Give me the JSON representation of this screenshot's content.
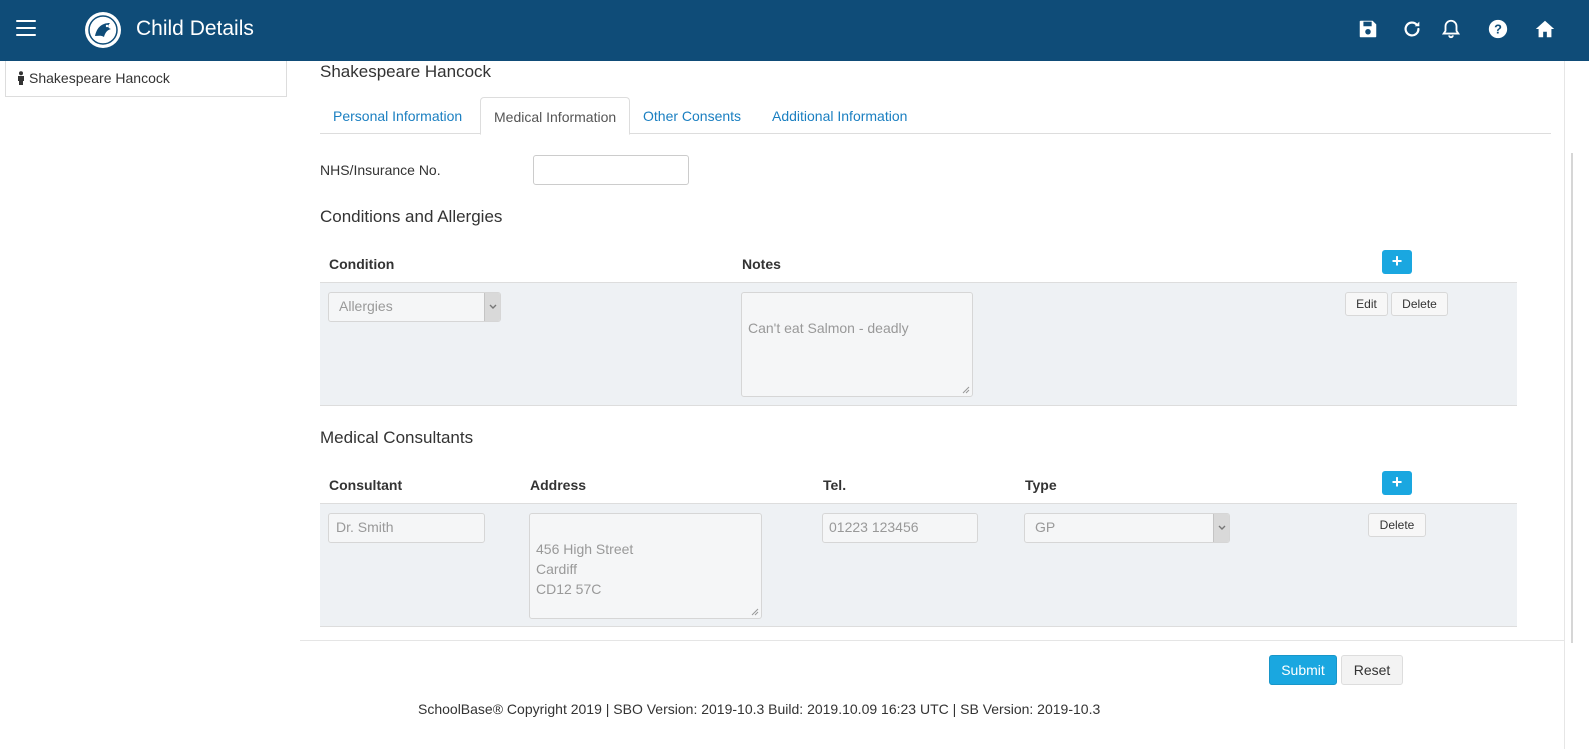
{
  "header": {
    "title": "Child Details",
    "icons": [
      "menu-icon",
      "logo",
      "save-icon",
      "refresh-icon",
      "bell-icon",
      "help-icon",
      "home-icon"
    ],
    "background": "#0f4c78"
  },
  "sidebar": {
    "items": [
      {
        "label": "Shakespeare Hancock",
        "icon": "person-icon"
      }
    ]
  },
  "main": {
    "student_name": "Shakespeare Hancock",
    "tabs": [
      {
        "label": "Personal Information",
        "active": false
      },
      {
        "label": "Medical Information",
        "active": true
      },
      {
        "label": "Other Consents",
        "active": false
      },
      {
        "label": "Additional Information",
        "active": false
      }
    ],
    "nhs": {
      "label": "NHS/Insurance No.",
      "value": ""
    },
    "conditions": {
      "heading": "Conditions and Allergies",
      "columns": [
        "Condition",
        "Notes"
      ],
      "add_label": "+",
      "rows": [
        {
          "condition": "Allergies",
          "notes": "Can't eat Salmon - deadly",
          "edit_label": "Edit",
          "delete_label": "Delete"
        }
      ]
    },
    "consultants": {
      "heading": "Medical Consultants",
      "columns": [
        "Consultant",
        "Address",
        "Tel.",
        "Type"
      ],
      "add_label": "+",
      "rows": [
        {
          "consultant": "Dr. Smith",
          "address": "456 High Street\nCardiff\nCD12 57C",
          "tel": "01223 123456",
          "type": "GP",
          "delete_label": "Delete"
        }
      ]
    }
  },
  "actions": {
    "submit_label": "Submit",
    "reset_label": "Reset"
  },
  "footer": {
    "text": "SchoolBase® Copyright 2019 | SBO Version: 2019-10.3 Build: 2019.10.09 16:23 UTC | SB Version: 2019-10.3"
  },
  "colors": {
    "accent": "#1aa7e0",
    "link": "#1a7fc1",
    "row_bg": "#eef1f4"
  }
}
